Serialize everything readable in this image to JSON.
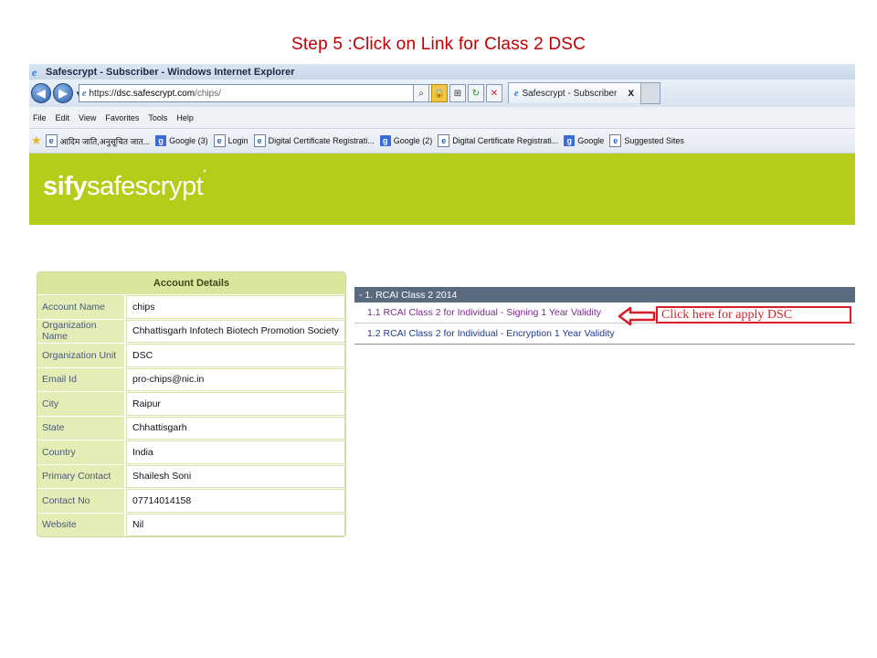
{
  "slide": {
    "title": "Step 5 :Click on Link for Class 2 DSC"
  },
  "browser": {
    "window_title": "Safescrypt - Subscriber - Windows Internet Explorer",
    "url_scheme": "https://",
    "url_host": "dsc.safescrypt.com",
    "url_path": "/chips/",
    "tab_title": "Safescrypt - Subscriber",
    "tab_close": "x",
    "menu": [
      "File",
      "Edit",
      "View",
      "Favorites",
      "Tools",
      "Help"
    ],
    "favorites": [
      {
        "icon": "page-icon",
        "label": "आदिम जाति,अनुसूचित जात..."
      },
      {
        "icon": "google-icon",
        "label": "Google (3)"
      },
      {
        "icon": "page-icon",
        "label": "Login"
      },
      {
        "icon": "page-icon",
        "label": "Digital Certificate Registrati..."
      },
      {
        "icon": "google-icon",
        "label": "Google (2)"
      },
      {
        "icon": "page-icon",
        "label": "Digital Certificate Registrati..."
      },
      {
        "icon": "google-icon",
        "label": "Google"
      },
      {
        "icon": "page-icon",
        "label": "Suggested Sites"
      }
    ]
  },
  "banner": {
    "logo_part1": "sify",
    "logo_part2": "safescrypt",
    "logo_tm": "*",
    "color": "#b5cc18"
  },
  "account": {
    "heading": "Account Details",
    "rows": [
      {
        "label": "Account Name",
        "value": "chips"
      },
      {
        "label": "Organization Name",
        "value": "Chhattisgarh Infotech Biotech Promotion Society"
      },
      {
        "label": "Organization Unit",
        "value": "DSC"
      },
      {
        "label": "Email Id",
        "value": "pro-chips@nic.in"
      },
      {
        "label": "City",
        "value": "Raipur"
      },
      {
        "label": "State",
        "value": "Chhattisgarh"
      },
      {
        "label": "Country",
        "value": "India"
      },
      {
        "label": "Primary Contact",
        "value": "Shailesh Soni"
      },
      {
        "label": "Contact No",
        "value": "07714014158"
      },
      {
        "label": "Website",
        "value": "Nil"
      }
    ]
  },
  "rcai": {
    "header": "- 1. RCAI Class 2 2014",
    "links": [
      "1.1 RCAI Class 2 for Individual - Signing 1 Year Validity",
      "1.2 RCAI Class 2 for Individual - Encryption 1 Year Validity"
    ]
  },
  "callout": {
    "text": "Click here for apply DSC",
    "color": "#d81e28"
  }
}
